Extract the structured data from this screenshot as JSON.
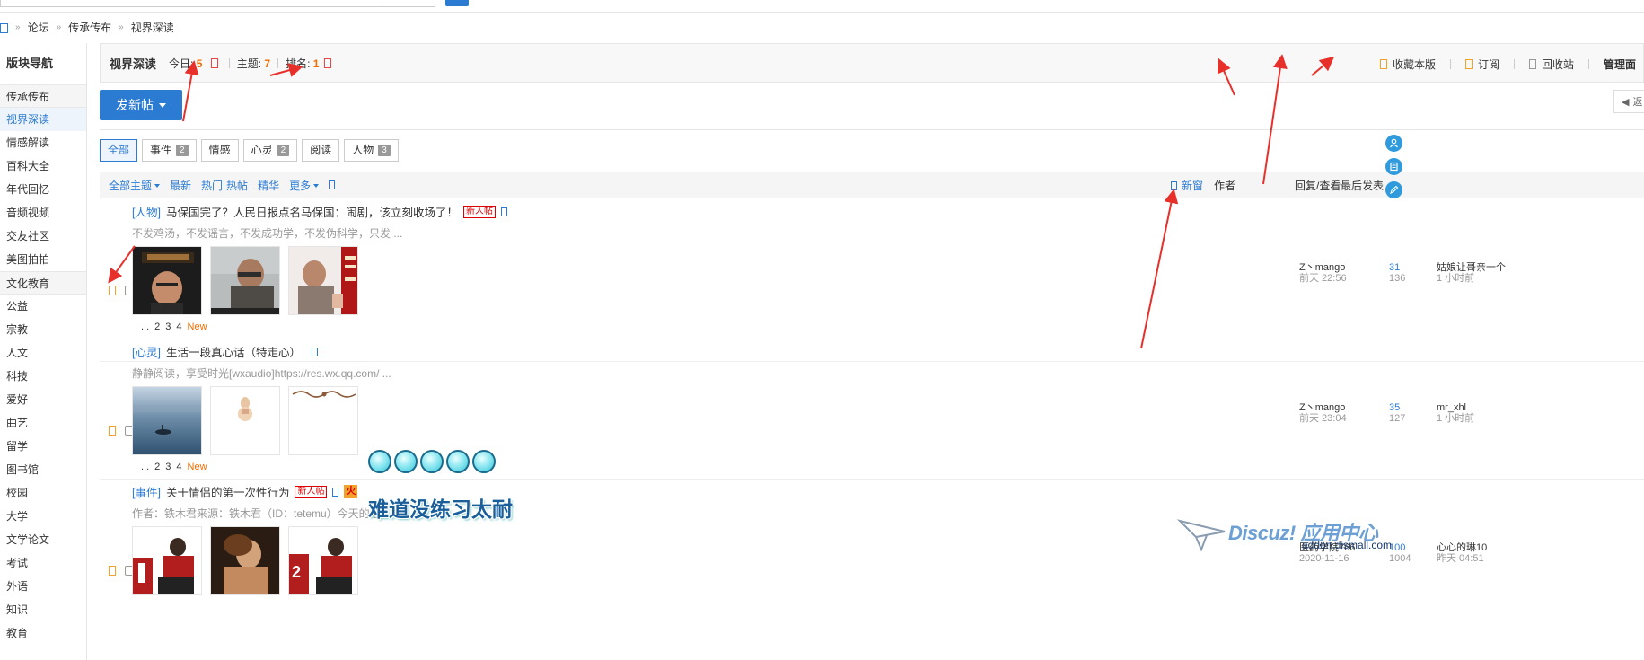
{
  "breadcrumb": {
    "items": [
      "论坛",
      "传承传布",
      "视界深读"
    ],
    "sep": "»"
  },
  "sidebar": {
    "title": "版块导航",
    "items": [
      {
        "label": "传承传布",
        "group": true
      },
      {
        "label": "视界深读",
        "active": true
      },
      {
        "label": "情感解读"
      },
      {
        "label": "百科大全"
      },
      {
        "label": "年代回忆"
      },
      {
        "label": "音频视频"
      },
      {
        "label": "交友社区"
      },
      {
        "label": "美图拍拍"
      },
      {
        "label": "文化教育",
        "group": true
      },
      {
        "label": "公益"
      },
      {
        "label": "宗教"
      },
      {
        "label": "人文"
      },
      {
        "label": "科技"
      },
      {
        "label": "爱好"
      },
      {
        "label": "曲艺"
      },
      {
        "label": "留学"
      },
      {
        "label": "图书馆"
      },
      {
        "label": "校园"
      },
      {
        "label": "大学"
      },
      {
        "label": "文学论文"
      },
      {
        "label": "考试"
      },
      {
        "label": "外语"
      },
      {
        "label": "知识"
      },
      {
        "label": "教育"
      }
    ]
  },
  "forum": {
    "name": "视界深读",
    "today_label": "今日:",
    "today_value": "5",
    "topics_label": "主题:",
    "topics_value": "7",
    "rank_label": "排名:",
    "rank_value": "1",
    "favorite": "收藏本版",
    "subscribe": "订阅",
    "recycle": "回收站",
    "admin": "管理面"
  },
  "actions": {
    "new_post": "发新帖",
    "back": "返"
  },
  "tabs": [
    {
      "label": "全部",
      "active": true
    },
    {
      "label": "事件",
      "count": "2"
    },
    {
      "label": "情感"
    },
    {
      "label": "心灵",
      "count": "2"
    },
    {
      "label": "阅读"
    },
    {
      "label": "人物",
      "count": "3"
    }
  ],
  "filter": {
    "all_topics": "全部主题",
    "latest": "最新",
    "hot": "热门",
    "hot_posts": "热帖",
    "digest": "精华",
    "more": "更多",
    "new_window": "新窗",
    "col_author": "作者",
    "col_reply": "回复/查看",
    "col_last": "最后发表"
  },
  "threads": [
    {
      "category": "[人物]",
      "title": "马保国完了？人民日报点名马保国：闹剧，该立刻收场了！",
      "badge": "新人帖",
      "summary": "不发鸡汤，不发谣言，不发成功学，不发伪科学，只发 ...",
      "pages": [
        "...",
        "2",
        "3",
        "4"
      ],
      "new_label": "New",
      "author": "Z丶mango",
      "post_time": "前天 22:56",
      "replies": "31",
      "views": "136",
      "last_author": "姑娘让哥亲一个",
      "last_time": "1 小时前"
    },
    {
      "category": "[心灵]",
      "title": "生活一段真心话（特走心）",
      "summary": "静静阅读，享受时光[wxaudio]https://res.wx.qq.com/ ...",
      "pages": [
        "...",
        "2",
        "3",
        "4"
      ],
      "new_label": "New",
      "author": "Z丶mango",
      "post_time": "前天 23:04",
      "replies": "35",
      "views": "127",
      "last_author": "mr_xhl",
      "last_time": "1 小时前"
    },
    {
      "category": "[事件]",
      "title": "关于情侣的第一次性行为",
      "badge": "新人帖",
      "hot": "火",
      "summary": "作者：铁木君来源：铁木君（ID：tetemu）今天的话 ...",
      "author": "医药学院766",
      "post_time": "2020-11-16",
      "replies": "100",
      "views": "1004",
      "last_author": "心心的琳10",
      "last_time": "昨天 04:51"
    }
  ],
  "overlay": {
    "text": "难道没练习太耐"
  },
  "watermark": {
    "brand": "Discuz! 应用中心",
    "site": "addon.dismall.com"
  },
  "float_buttons": [
    "user-icon",
    "doc-icon",
    "edit-icon"
  ],
  "colors": {
    "accent": "#2b7bd3",
    "highlight": "#f26c00",
    "arrow": "#e8302b"
  }
}
